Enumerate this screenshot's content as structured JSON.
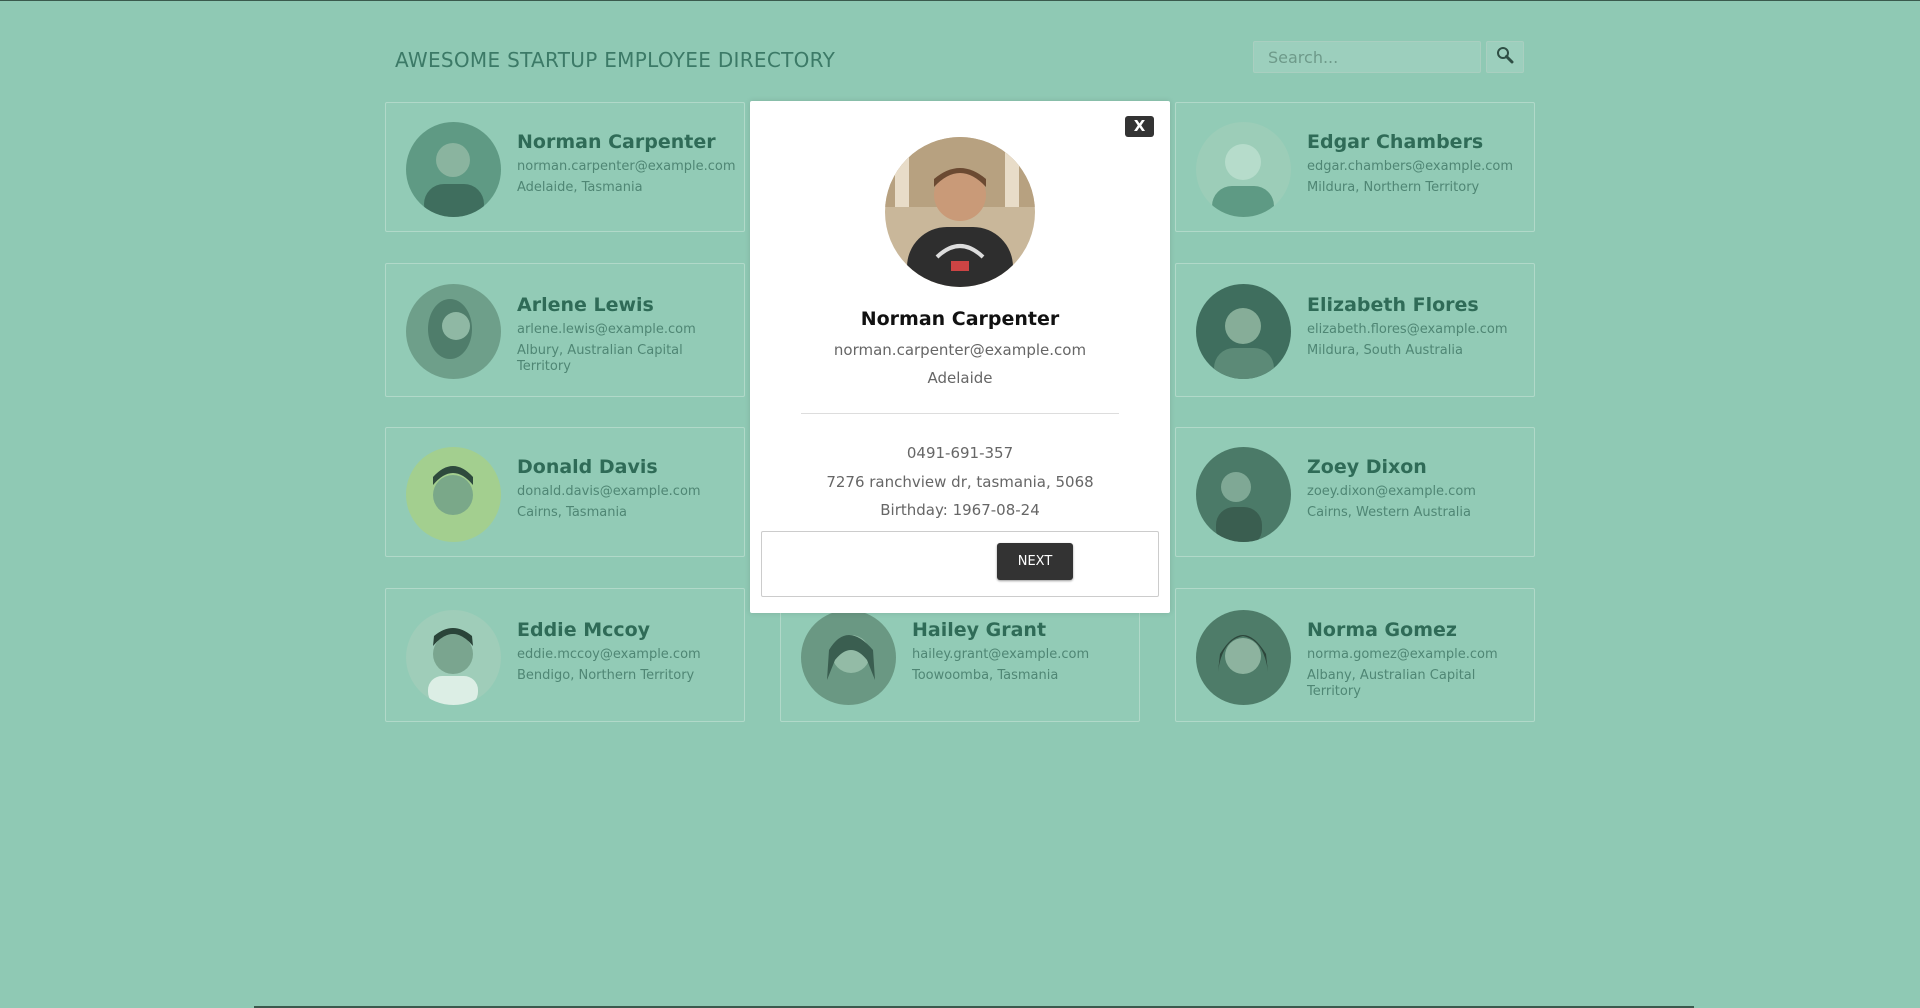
{
  "header": {
    "title": "AWESOME STARTUP EMPLOYEE DIRECTORY",
    "search_placeholder": "Search..."
  },
  "employees": [
    {
      "name": "Norman Carpenter",
      "email": "norman.carpenter@example.com",
      "location": "Adelaide, Tasmania"
    },
    {
      "name": "Edgar Chambers",
      "email": "edgar.chambers@example.com",
      "location": "Mildura, Northern Territory"
    },
    {
      "name": "Arlene Lewis",
      "email": "arlene.lewis@example.com",
      "location": "Albury, Australian Capital Territory"
    },
    {
      "name": "Elizabeth Flores",
      "email": "elizabeth.flores@example.com",
      "location": "Mildura, South Australia"
    },
    {
      "name": "Donald Davis",
      "email": "donald.davis@example.com",
      "location": "Cairns, Tasmania"
    },
    {
      "name": "Zoey Dixon",
      "email": "zoey.dixon@example.com",
      "location": "Cairns, Western Australia"
    },
    {
      "name": "Eddie Mccoy",
      "email": "eddie.mccoy@example.com",
      "location": "Bendigo, Northern Territory"
    },
    {
      "name": "Hailey Grant",
      "email": "hailey.grant@example.com",
      "location": "Toowoomba, Tasmania"
    },
    {
      "name": "Norma Gomez",
      "email": "norma.gomez@example.com",
      "location": "Albany, Australian Capital Territory"
    }
  ],
  "modal": {
    "close_label": "X",
    "name": "Norman Carpenter",
    "email": "norman.carpenter@example.com",
    "city": "Adelaide",
    "phone": "0491-691-357",
    "address": "7276 ranchview dr, tasmania, 5068",
    "birthday": "Birthday: 1967-08-24",
    "next_label": "NEXT"
  },
  "icons": {
    "search": "search-icon",
    "close": "close-icon"
  },
  "colors": {
    "overlay": "#8fc9b4",
    "accent_text": "#3c7a67",
    "button_dark": "#333333"
  }
}
